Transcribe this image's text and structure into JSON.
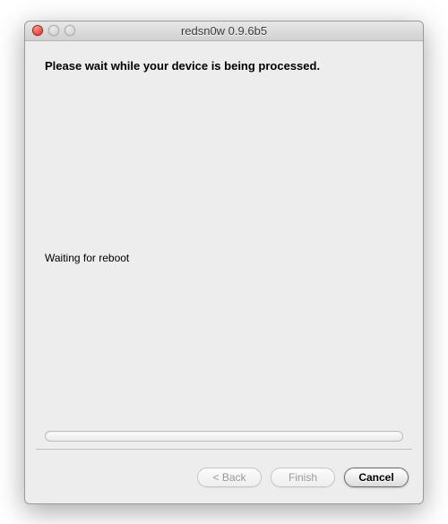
{
  "window": {
    "title": "redsn0w 0.9.6b5"
  },
  "content": {
    "instruction": "Please wait while your device is being processed.",
    "status": "Waiting for reboot",
    "progress_percent": 0
  },
  "footer": {
    "back_label": "< Back",
    "finish_label": "Finish",
    "cancel_label": "Cancel"
  }
}
